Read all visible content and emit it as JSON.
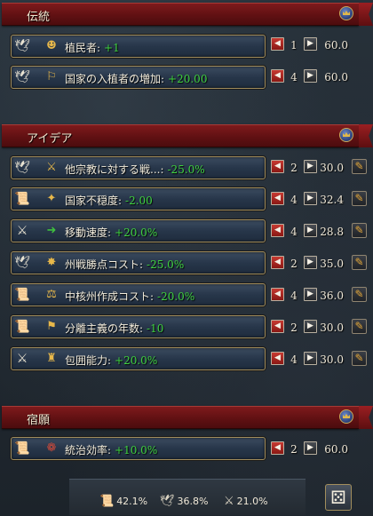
{
  "sections": [
    {
      "title": "伝統",
      "rows": [
        {
          "cat": "admin",
          "icon": "colonist-icon",
          "name": "植民者:",
          "value": "+1",
          "level": "1",
          "cost": "60.0",
          "editable": false
        },
        {
          "cat": "admin",
          "icon": "settlers-icon",
          "name": "国家の入植者の増加:",
          "value": "+20.00",
          "level": "4",
          "cost": "60.0",
          "editable": false
        }
      ]
    },
    {
      "title": "アイデア",
      "rows": [
        {
          "cat": "admin",
          "icon": "religion-war-icon",
          "name": "他宗教に対する戦...:",
          "value": "-25.0%",
          "level": "2",
          "cost": "30.0",
          "editable": true
        },
        {
          "cat": "dip",
          "icon": "unrest-icon",
          "name": "国家不穏度:",
          "value": "-2.00",
          "level": "4",
          "cost": "32.4",
          "editable": true
        },
        {
          "cat": "mil",
          "icon": "movement-icon",
          "name": "移動速度:",
          "value": "+20.0%",
          "level": "4",
          "cost": "28.8",
          "editable": true
        },
        {
          "cat": "admin",
          "icon": "war-score-icon",
          "name": "州戦勝点コスト:",
          "value": "-25.0%",
          "level": "2",
          "cost": "35.0",
          "editable": true
        },
        {
          "cat": "dip",
          "icon": "core-cost-icon",
          "name": "中核州作成コスト:",
          "value": "-20.0%",
          "level": "4",
          "cost": "36.0",
          "editable": true
        },
        {
          "cat": "dip",
          "icon": "separatism-icon",
          "name": "分離主義の年数:",
          "value": "-10",
          "level": "2",
          "cost": "30.0",
          "editable": true
        },
        {
          "cat": "mil",
          "icon": "siege-icon",
          "name": "包囲能力:",
          "value": "+20.0%",
          "level": "4",
          "cost": "30.0",
          "editable": true
        }
      ]
    },
    {
      "title": "宿願",
      "rows": [
        {
          "cat": "dip",
          "icon": "governing-icon",
          "name": "統治効率:",
          "value": "+10.0%",
          "level": "2",
          "cost": "60.0",
          "editable": false
        }
      ]
    }
  ],
  "footer": {
    "dip": "42.1%",
    "admin": "36.8%",
    "mil": "21.0%"
  }
}
